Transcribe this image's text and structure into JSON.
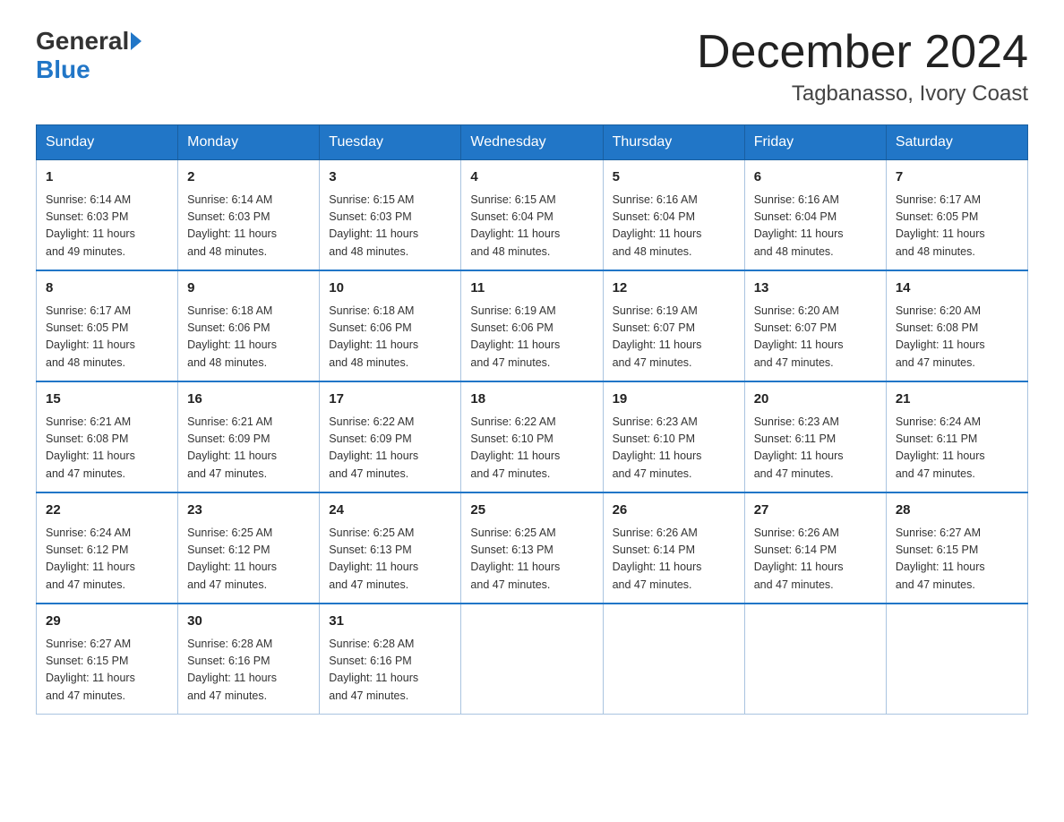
{
  "logo": {
    "general": "General",
    "blue": "Blue"
  },
  "title": "December 2024",
  "location": "Tagbanasso, Ivory Coast",
  "days_of_week": [
    "Sunday",
    "Monday",
    "Tuesday",
    "Wednesday",
    "Thursday",
    "Friday",
    "Saturday"
  ],
  "weeks": [
    [
      {
        "day": "1",
        "sunrise": "6:14 AM",
        "sunset": "6:03 PM",
        "daylight": "11 hours and 49 minutes."
      },
      {
        "day": "2",
        "sunrise": "6:14 AM",
        "sunset": "6:03 PM",
        "daylight": "11 hours and 48 minutes."
      },
      {
        "day": "3",
        "sunrise": "6:15 AM",
        "sunset": "6:03 PM",
        "daylight": "11 hours and 48 minutes."
      },
      {
        "day": "4",
        "sunrise": "6:15 AM",
        "sunset": "6:04 PM",
        "daylight": "11 hours and 48 minutes."
      },
      {
        "day": "5",
        "sunrise": "6:16 AM",
        "sunset": "6:04 PM",
        "daylight": "11 hours and 48 minutes."
      },
      {
        "day": "6",
        "sunrise": "6:16 AM",
        "sunset": "6:04 PM",
        "daylight": "11 hours and 48 minutes."
      },
      {
        "day": "7",
        "sunrise": "6:17 AM",
        "sunset": "6:05 PM",
        "daylight": "11 hours and 48 minutes."
      }
    ],
    [
      {
        "day": "8",
        "sunrise": "6:17 AM",
        "sunset": "6:05 PM",
        "daylight": "11 hours and 48 minutes."
      },
      {
        "day": "9",
        "sunrise": "6:18 AM",
        "sunset": "6:06 PM",
        "daylight": "11 hours and 48 minutes."
      },
      {
        "day": "10",
        "sunrise": "6:18 AM",
        "sunset": "6:06 PM",
        "daylight": "11 hours and 48 minutes."
      },
      {
        "day": "11",
        "sunrise": "6:19 AM",
        "sunset": "6:06 PM",
        "daylight": "11 hours and 47 minutes."
      },
      {
        "day": "12",
        "sunrise": "6:19 AM",
        "sunset": "6:07 PM",
        "daylight": "11 hours and 47 minutes."
      },
      {
        "day": "13",
        "sunrise": "6:20 AM",
        "sunset": "6:07 PM",
        "daylight": "11 hours and 47 minutes."
      },
      {
        "day": "14",
        "sunrise": "6:20 AM",
        "sunset": "6:08 PM",
        "daylight": "11 hours and 47 minutes."
      }
    ],
    [
      {
        "day": "15",
        "sunrise": "6:21 AM",
        "sunset": "6:08 PM",
        "daylight": "11 hours and 47 minutes."
      },
      {
        "day": "16",
        "sunrise": "6:21 AM",
        "sunset": "6:09 PM",
        "daylight": "11 hours and 47 minutes."
      },
      {
        "day": "17",
        "sunrise": "6:22 AM",
        "sunset": "6:09 PM",
        "daylight": "11 hours and 47 minutes."
      },
      {
        "day": "18",
        "sunrise": "6:22 AM",
        "sunset": "6:10 PM",
        "daylight": "11 hours and 47 minutes."
      },
      {
        "day": "19",
        "sunrise": "6:23 AM",
        "sunset": "6:10 PM",
        "daylight": "11 hours and 47 minutes."
      },
      {
        "day": "20",
        "sunrise": "6:23 AM",
        "sunset": "6:11 PM",
        "daylight": "11 hours and 47 minutes."
      },
      {
        "day": "21",
        "sunrise": "6:24 AM",
        "sunset": "6:11 PM",
        "daylight": "11 hours and 47 minutes."
      }
    ],
    [
      {
        "day": "22",
        "sunrise": "6:24 AM",
        "sunset": "6:12 PM",
        "daylight": "11 hours and 47 minutes."
      },
      {
        "day": "23",
        "sunrise": "6:25 AM",
        "sunset": "6:12 PM",
        "daylight": "11 hours and 47 minutes."
      },
      {
        "day": "24",
        "sunrise": "6:25 AM",
        "sunset": "6:13 PM",
        "daylight": "11 hours and 47 minutes."
      },
      {
        "day": "25",
        "sunrise": "6:25 AM",
        "sunset": "6:13 PM",
        "daylight": "11 hours and 47 minutes."
      },
      {
        "day": "26",
        "sunrise": "6:26 AM",
        "sunset": "6:14 PM",
        "daylight": "11 hours and 47 minutes."
      },
      {
        "day": "27",
        "sunrise": "6:26 AM",
        "sunset": "6:14 PM",
        "daylight": "11 hours and 47 minutes."
      },
      {
        "day": "28",
        "sunrise": "6:27 AM",
        "sunset": "6:15 PM",
        "daylight": "11 hours and 47 minutes."
      }
    ],
    [
      {
        "day": "29",
        "sunrise": "6:27 AM",
        "sunset": "6:15 PM",
        "daylight": "11 hours and 47 minutes."
      },
      {
        "day": "30",
        "sunrise": "6:28 AM",
        "sunset": "6:16 PM",
        "daylight": "11 hours and 47 minutes."
      },
      {
        "day": "31",
        "sunrise": "6:28 AM",
        "sunset": "6:16 PM",
        "daylight": "11 hours and 47 minutes."
      },
      null,
      null,
      null,
      null
    ]
  ],
  "labels": {
    "sunrise": "Sunrise:",
    "sunset": "Sunset:",
    "daylight": "Daylight:"
  }
}
